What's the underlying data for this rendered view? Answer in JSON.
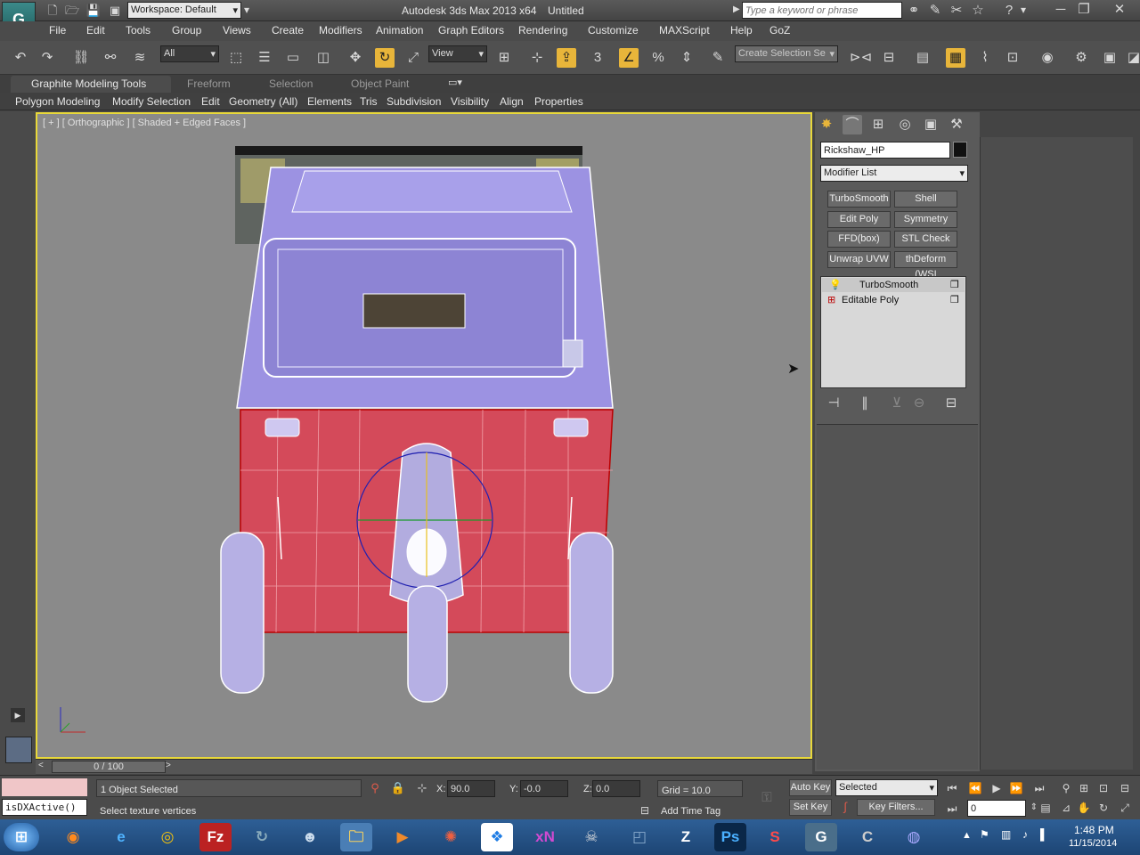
{
  "titlebar": {
    "workspace": "Workspace: Default",
    "app_title": "Autodesk 3ds Max 2013 x64",
    "doc_title": "Untitled",
    "search_placeholder": "Type a keyword or phrase"
  },
  "menu": [
    "File",
    "Edit",
    "Tools",
    "Group",
    "Views",
    "Create",
    "Modifiers",
    "Animation",
    "Graph Editors",
    "Rendering",
    "Customize",
    "MAXScript",
    "Help",
    "GoZ"
  ],
  "toolbar": {
    "filter": "All",
    "refcoord": "View",
    "selection_set_placeholder": "Create Selection Se"
  },
  "ribbon": {
    "tabs": [
      "Graphite Modeling Tools",
      "Freeform",
      "Selection",
      "Object Paint"
    ],
    "active_tab": "Graphite Modeling Tools",
    "panels": [
      "Polygon Modeling",
      "Modify Selection",
      "Edit",
      "Geometry (All)",
      "Elements",
      "Tris",
      "Subdivision",
      "Visibility",
      "Align",
      "Properties"
    ]
  },
  "viewport": {
    "label": "[ + ] [ Orthographic ] [ Shaded + Edged Faces ]"
  },
  "command_panel": {
    "object_name": "Rickshaw_HP",
    "modifier_list": "Modifier List",
    "buttons": [
      "TurboSmooth",
      "Shell",
      "Edit Poly",
      "Symmetry",
      "FFD(box)",
      "STL Check",
      "Unwrap UVW",
      "thDeform (WSI"
    ],
    "stack": [
      "TurboSmooth",
      "Editable Poly"
    ]
  },
  "timeline": {
    "frame": "0 / 100"
  },
  "status": {
    "selected": "1 Object Selected",
    "prompt": "Select texture vertices",
    "script": "isDXActive()",
    "x_label": "X:",
    "x": "90.0",
    "y_label": "Y:",
    "y": "-0.0",
    "z_label": "Z:",
    "z": "0.0",
    "grid": "Grid = 10.0",
    "auto_key": "Auto Key",
    "set_key": "Set Key",
    "key_mode": "Selected",
    "key_filters": "Key Filters...",
    "time_tag": "Add Time Tag",
    "frame_field": "0"
  },
  "taskbar": {
    "time": "1:48 PM",
    "date": "11/15/2014"
  },
  "colors": {
    "accent": "#e8b53a",
    "viewport_border": "#e8d83a",
    "selection_red": "#d44a5a",
    "body_blue": "#9a8fe0"
  }
}
